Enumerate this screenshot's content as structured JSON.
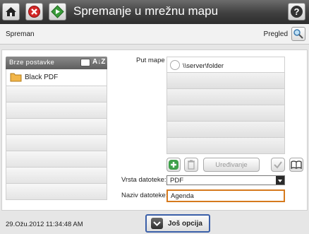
{
  "titlebar": {
    "title": "Spremanje u mrežnu mapu",
    "home_icon": "home-icon",
    "stop_icon": "stop-icon",
    "start_icon": "start-icon",
    "help_icon": "help-icon"
  },
  "status": {
    "text": "Spreman",
    "preview_label": "Pregled"
  },
  "quick_sets": {
    "header": "Brze postavke",
    "sort_label": "A↓Z",
    "items": [
      {
        "label": "Black PDF",
        "icon": "folder-icon"
      }
    ],
    "empty_rows": 7
  },
  "form": {
    "folder_path_label": "Put mape",
    "folders": [
      "\\\\server\\folder"
    ],
    "edit_label": "Uređivanje",
    "file_type_label": "Vrsta datoteke:",
    "file_type_value": "PDF",
    "file_name_label": "Naziv datoteke:",
    "file_name_value": "Agenda"
  },
  "footer": {
    "datetime": "29.Ožu.2012 11:34:48 AM",
    "more_options_label": "Još opcija"
  },
  "colors": {
    "title_bar": "#3f3f3f",
    "focus_border": "#d67a1e",
    "more_options_border": "#3a5fa8",
    "stop_red": "#d32626",
    "start_green": "#3a9b3a"
  }
}
